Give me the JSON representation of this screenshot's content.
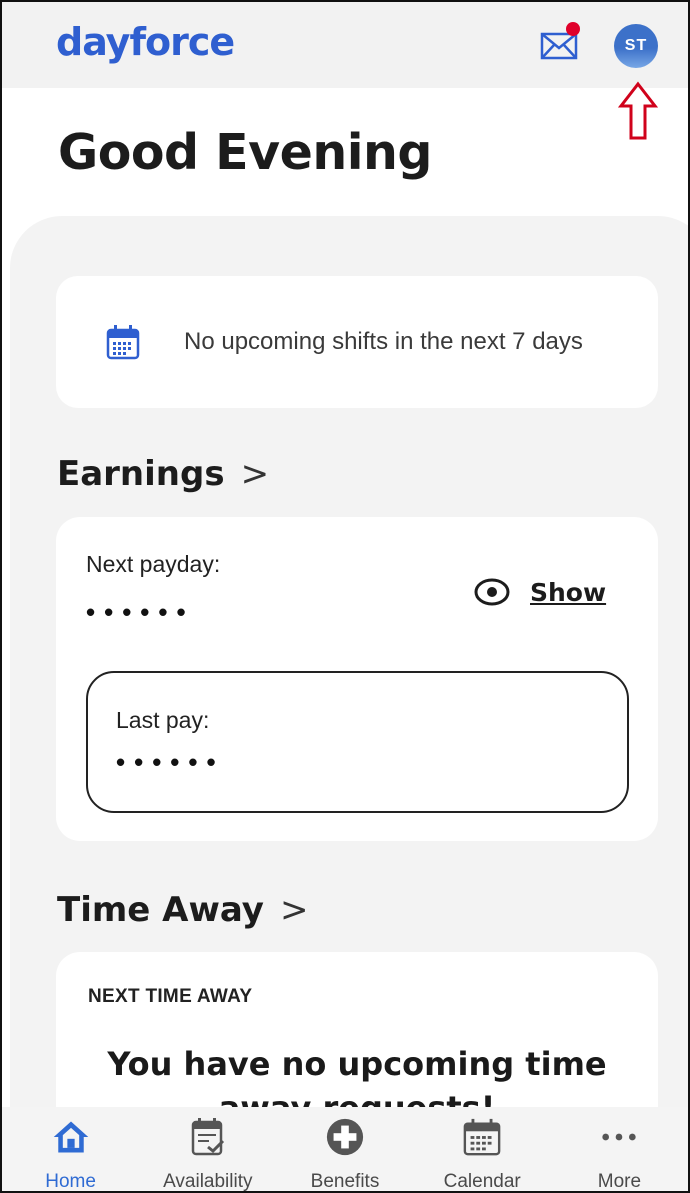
{
  "header": {
    "logo": "dayforce",
    "avatar_initials": "ST",
    "has_unread_mail": true
  },
  "greeting": "Good Evening",
  "shifts": {
    "message": "No upcoming shifts in the next 7 days",
    "icon": "calendar-icon"
  },
  "earnings": {
    "title": "Earnings",
    "chevron": ">",
    "next_payday_label": "Next payday:",
    "next_payday_value": "••••••",
    "show_label": "Show",
    "last_pay_label": "Last pay:",
    "last_pay_value": "••••••"
  },
  "time_away": {
    "title": "Time Away",
    "chevron": ">",
    "caption": "NEXT TIME AWAY",
    "message": "You have no upcoming time away requests!"
  },
  "nav": {
    "items": [
      {
        "label": "Home",
        "icon": "home-icon",
        "active": true
      },
      {
        "label": "Availability",
        "icon": "availability-icon",
        "active": false
      },
      {
        "label": "Benefits",
        "icon": "benefits-icon",
        "active": false
      },
      {
        "label": "Calendar",
        "icon": "calendar-icon",
        "active": false
      },
      {
        "label": "More",
        "icon": "more-icon",
        "active": false
      }
    ]
  },
  "colors": {
    "brand": "#2f5fd0",
    "active_nav": "#2f6bd3",
    "notification": "#e0002a",
    "annotation_arrow": "#d0021b"
  }
}
